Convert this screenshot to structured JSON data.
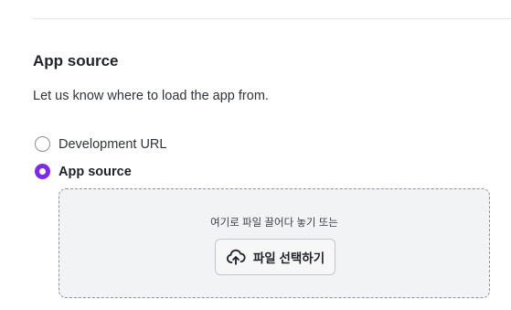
{
  "section": {
    "title": "App source",
    "description": "Let us know where to load the app from."
  },
  "source_options": [
    {
      "label": "Development URL",
      "selected": false
    },
    {
      "label": "App source",
      "selected": true
    }
  ],
  "dropzone": {
    "hint": "여기로 파일 끌어다 놓기 또는",
    "button_label": "파일 선택하기",
    "button_icon": "cloud-upload-icon"
  },
  "colors": {
    "accent": "#7d2ae8",
    "dropzone_bg": "#f2f3f5"
  }
}
